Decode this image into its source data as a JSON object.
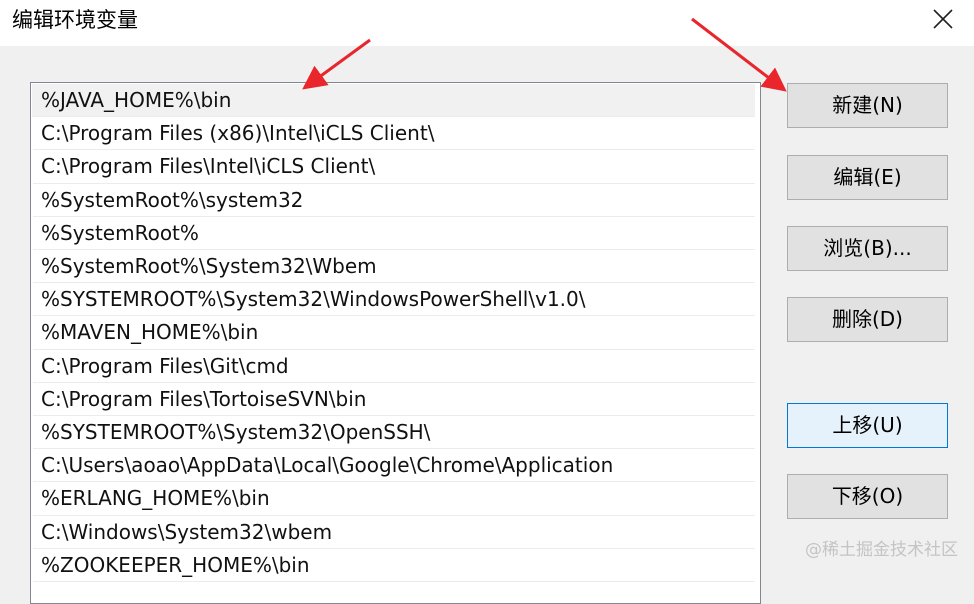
{
  "window": {
    "title": "编辑环境变量"
  },
  "list": {
    "items": [
      "%JAVA_HOME%\\bin",
      "C:\\Program Files (x86)\\Intel\\iCLS Client\\",
      "C:\\Program Files\\Intel\\iCLS Client\\",
      "%SystemRoot%\\system32",
      "%SystemRoot%",
      "%SystemRoot%\\System32\\Wbem",
      "%SYSTEMROOT%\\System32\\WindowsPowerShell\\v1.0\\",
      "%MAVEN_HOME%\\bin",
      "C:\\Program Files\\Git\\cmd",
      "C:\\Program Files\\TortoiseSVN\\bin",
      "%SYSTEMROOT%\\System32\\OpenSSH\\",
      "C:\\Users\\aoao\\AppData\\Local\\Google\\Chrome\\Application",
      "%ERLANG_HOME%\\bin",
      "C:\\Windows\\System32\\wbem",
      "%ZOOKEEPER_HOME%\\bin"
    ],
    "selected_index": 0
  },
  "buttons": {
    "new": "新建(N)",
    "edit": "编辑(E)",
    "browse": "浏览(B)...",
    "delete": "删除(D)",
    "move_up": "上移(U)",
    "move_down": "下移(O)"
  },
  "watermark": "@稀土掘金技术社区",
  "annotations": {
    "arrow_color": "#e8262b"
  },
  "icons": {
    "close": "close-icon"
  }
}
